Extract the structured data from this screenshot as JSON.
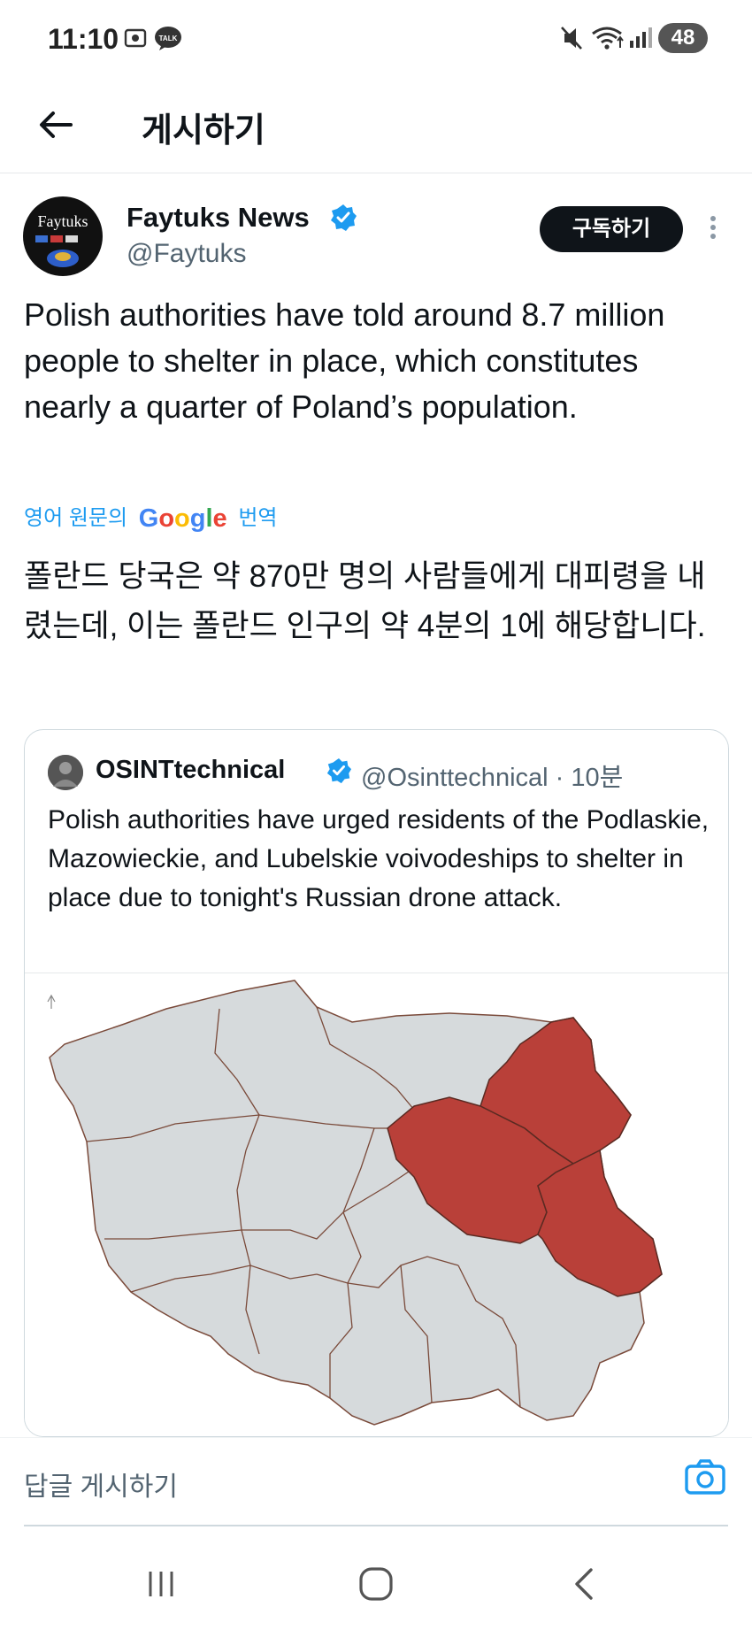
{
  "status_bar": {
    "time": "11:10",
    "battery": "48",
    "icons": [
      "screenshot-icon",
      "talk-icon",
      "mute-icon",
      "wifi-icon",
      "signal-icon"
    ],
    "talk_label": "TALK"
  },
  "header": {
    "title": "게시하기",
    "back_icon": "back-arrow-icon"
  },
  "tweet": {
    "author": {
      "name": "Faytuks News",
      "handle": "@Faytuks",
      "avatar_text": "Faytuks",
      "verified": true
    },
    "subscribe_label": "구독하기",
    "text": "Polish authorities have told around 8.7 million people to shelter in place, which constitutes nearly a quarter of Poland’s population.",
    "translate": {
      "prefix": "영어 원문의",
      "brand": "Google",
      "suffix": "번역"
    },
    "translated_text": "폴란드 당국은 약 870만 명의 사람들에게 대피령을 내렸는데, 이는 폴란드 인구의 약 4분의 1에 해당합니다."
  },
  "quoted_tweet": {
    "name": "OSINTtechnical",
    "handle_time": "@Osinttechnical · 10분",
    "verified": true,
    "text": "Polish authorities have urged residents of the Podlaskie, Mazowieckie, and Lubelskie voivodeships to shelter in place due to tonight's Russian drone attack.",
    "map": {
      "highlighted_regions": [
        "Podlaskie",
        "Mazowieckie",
        "Lubelskie"
      ],
      "highlight_color": "#b94039",
      "base_color": "#d6dadc"
    }
  },
  "reply": {
    "placeholder": "답글 게시하기",
    "camera_icon": "camera-icon"
  },
  "colors": {
    "accent": "#1d9bf0",
    "text": "#0f1419",
    "secondary": "#536471"
  },
  "nav_bar": {
    "buttons": [
      "recents-icon",
      "home-icon",
      "back-icon"
    ]
  }
}
